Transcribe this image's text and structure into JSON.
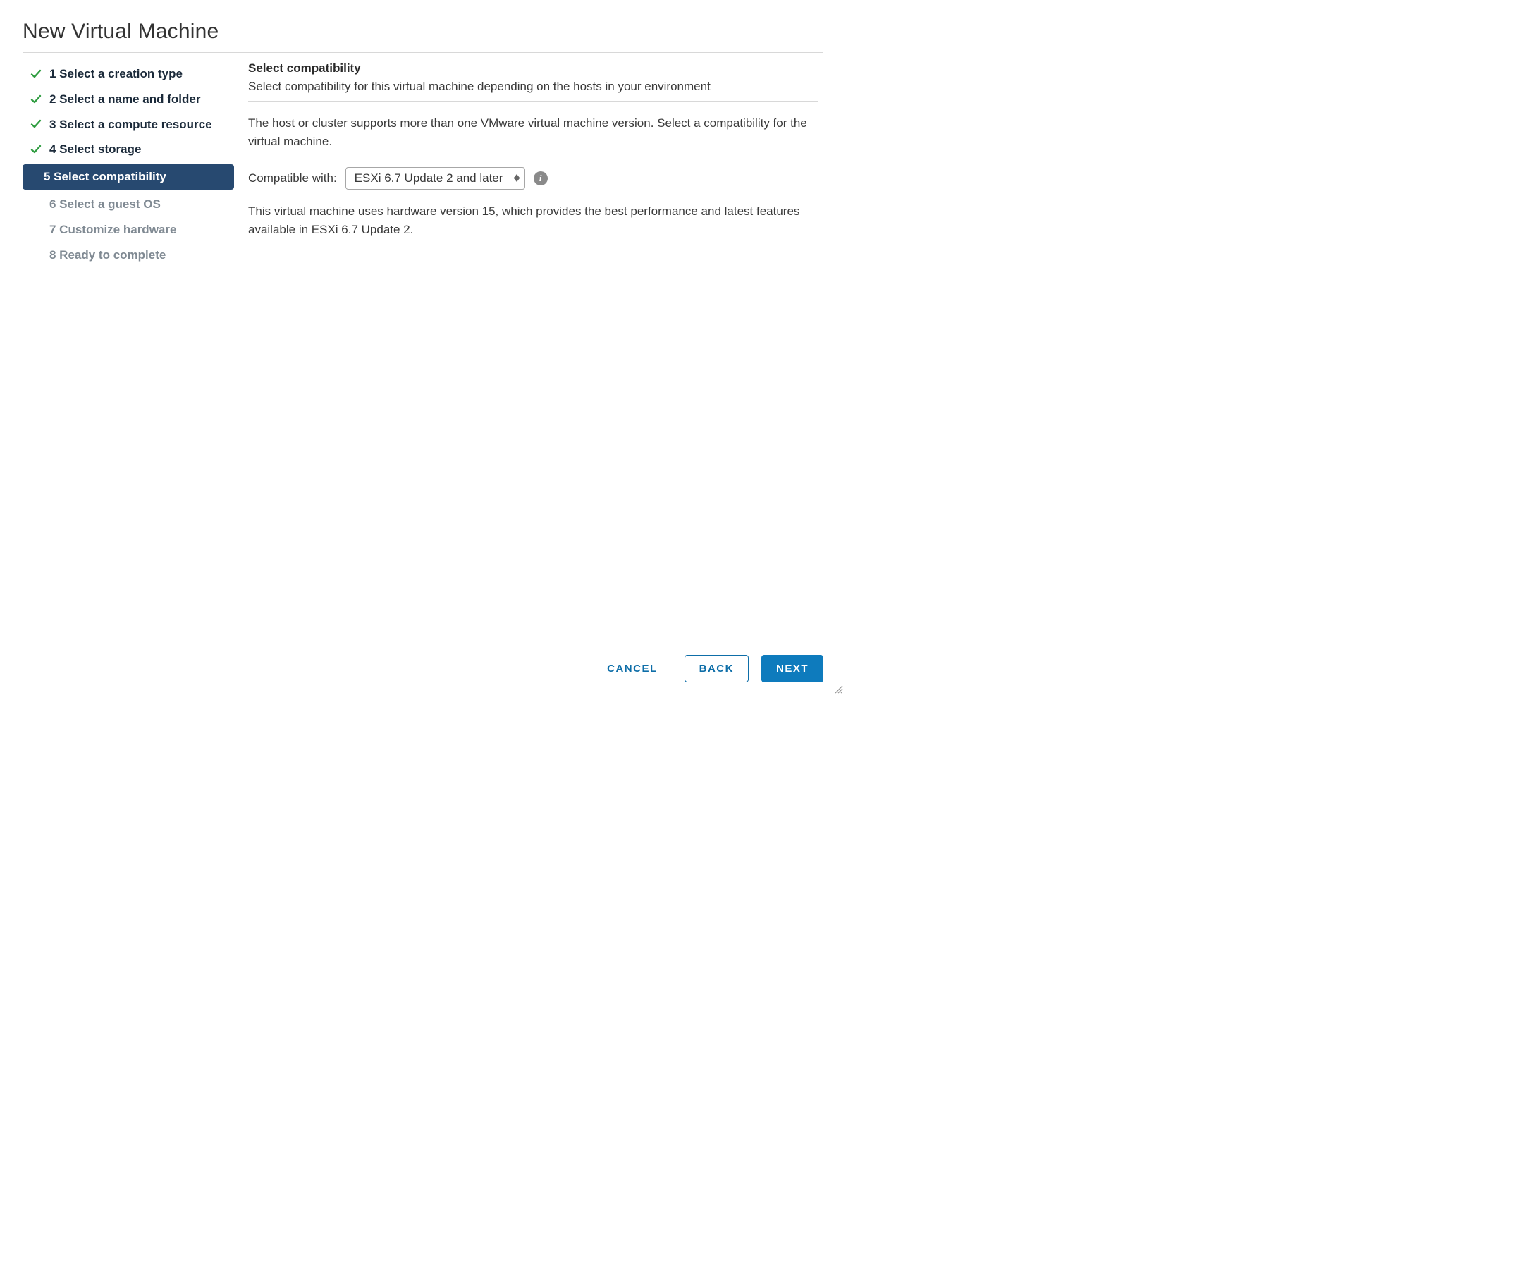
{
  "dialog": {
    "title": "New Virtual Machine"
  },
  "steps": {
    "items": [
      {
        "label": "1 Select a creation type"
      },
      {
        "label": "2 Select a name and folder"
      },
      {
        "label": "3 Select a compute resource"
      },
      {
        "label": "4 Select storage"
      },
      {
        "label": "5 Select compatibility"
      },
      {
        "label": "6 Select a guest OS"
      },
      {
        "label": "7 Customize hardware"
      },
      {
        "label": "8 Ready to complete"
      }
    ]
  },
  "main": {
    "section_title": "Select compatibility",
    "section_sub": "Select compatibility for this virtual machine depending on the hosts in your environment",
    "para1": "The host or cluster supports more than one VMware virtual machine version. Select a compatibility for the virtual machine.",
    "compat_label": "Compatible with:",
    "compat_value": "ESXi 6.7 Update 2 and later",
    "para2": "This virtual machine uses hardware version 15, which provides the best performance and latest features available in ESXi 6.7 Update 2."
  },
  "footer": {
    "cancel": "CANCEL",
    "back": "BACK",
    "next": "NEXT"
  }
}
